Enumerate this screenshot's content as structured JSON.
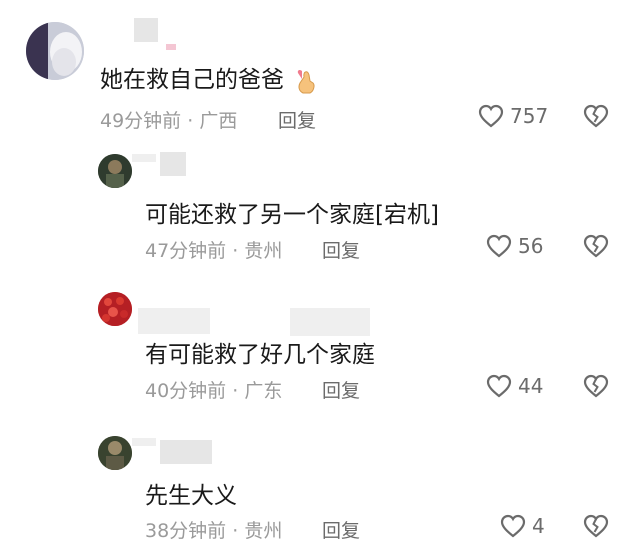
{
  "comments": [
    {
      "text": "她在救自己的爸爸",
      "emoji_icon": "finger-heart-icon",
      "time": "49分钟前",
      "location": "广西",
      "reply_label": "回复",
      "likes": "757"
    },
    {
      "text": "可能还救了另一个家庭[宕机]",
      "time": "47分钟前",
      "location": "贵州",
      "reply_label": "回复",
      "likes": "56"
    },
    {
      "text": "有可能救了好几个家庭",
      "time": "40分钟前",
      "location": "广东",
      "reply_label": "回复",
      "likes": "44"
    },
    {
      "text": "先生大义",
      "time": "38分钟前",
      "location": "贵州",
      "reply_label": "回复",
      "likes": "4"
    }
  ],
  "separator": "·",
  "icons": {
    "like": "heart-outline-icon",
    "dislike": "broken-heart-icon"
  },
  "colors": {
    "text": "#1a1a1a",
    "meta": "#9a9a9a",
    "icon": "#6b6b6b"
  }
}
